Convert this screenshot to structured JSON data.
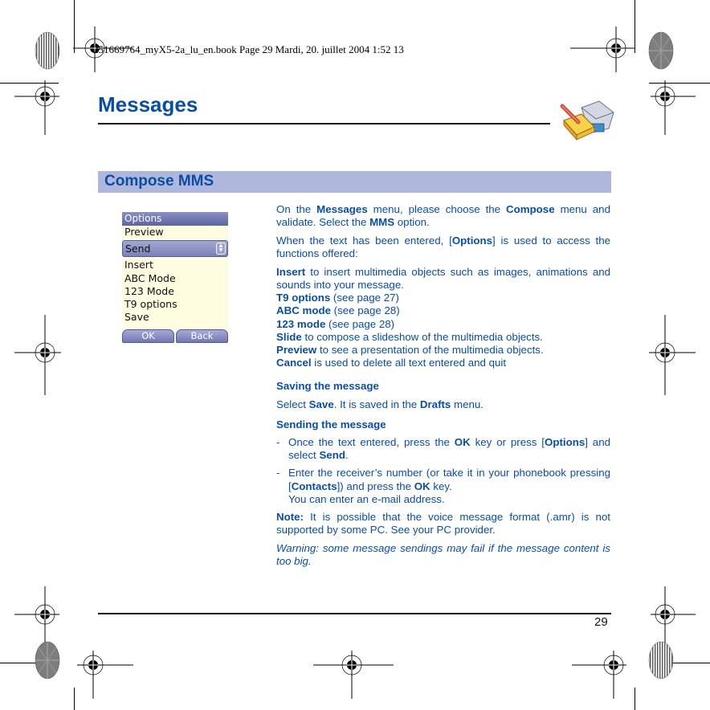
{
  "print_header": "251669764_myX5-2a_lu_en.book  Page 29  Mardi, 20. juillet 2004  1:52 13",
  "page": {
    "title": "Messages",
    "section_title": "Compose MMS",
    "page_number": "29",
    "title_icon": "messages-envelope-pencil-icon"
  },
  "phone_screen": {
    "header": "Options",
    "items": [
      "Preview",
      "Send",
      "Insert",
      "ABC Mode",
      "123 Mode",
      "T9 options",
      "Save"
    ],
    "selected_item": "Send",
    "softkeys": {
      "left": "OK",
      "right": "Back"
    }
  },
  "body": {
    "p1": {
      "t1": "On the ",
      "b1": "Messages",
      "t2": " menu, please choose the ",
      "b2": "Compose",
      "t3": " menu and validate. Select the ",
      "b3": "MMS",
      "t4": " option."
    },
    "p2": {
      "t1": "When the text has been entered, [",
      "b1": "Options",
      "t2": "] is used to access the functions offered:"
    },
    "functions": [
      {
        "term": "Insert",
        "desc": " to insert multimedia objects such as images, animations and sounds into your message."
      },
      {
        "term": "T9 options",
        "desc": " (see page 27)"
      },
      {
        "term": "ABC mode",
        "desc": " (see page 28)"
      },
      {
        "term": "123 mode",
        "desc": " (see page 28)"
      },
      {
        "term": "Slide",
        "desc": " to compose a slideshow of the multimedia objects."
      },
      {
        "term": "Preview",
        "desc": " to see a presentation of the multimedia objects."
      },
      {
        "term": "Cancel",
        "desc": " is used to delete all text entered and quit"
      }
    ],
    "saving": {
      "heading": "Saving the message",
      "t1": "Select ",
      "b1": "Save",
      "t2": ". It is saved in the ",
      "b2": "Drafts",
      "t3": " menu."
    },
    "sending": {
      "heading": "Sending the message",
      "step1": {
        "dash": "-",
        "t1": "Once the text entered, press the ",
        "b1": "OK",
        "t2": " key or press [",
        "b2": "Options",
        "t3": "] and select ",
        "b3": "Send",
        "t4": "."
      },
      "step2": {
        "dash": "-",
        "t1": "Enter the receiver’s number (or take it in your phonebook pressing [",
        "b1": "Contacts",
        "t2": "]) and press the ",
        "b2": "OK",
        "t3": " key.",
        "line2": "You can enter an e-mail address."
      }
    },
    "note": {
      "label": "Note:",
      "text": " It is possible that the voice message format (.amr) is not supported by some PC. See your PC provider."
    },
    "warning": "Warning: some message sendings may fail if the message content is too big."
  }
}
